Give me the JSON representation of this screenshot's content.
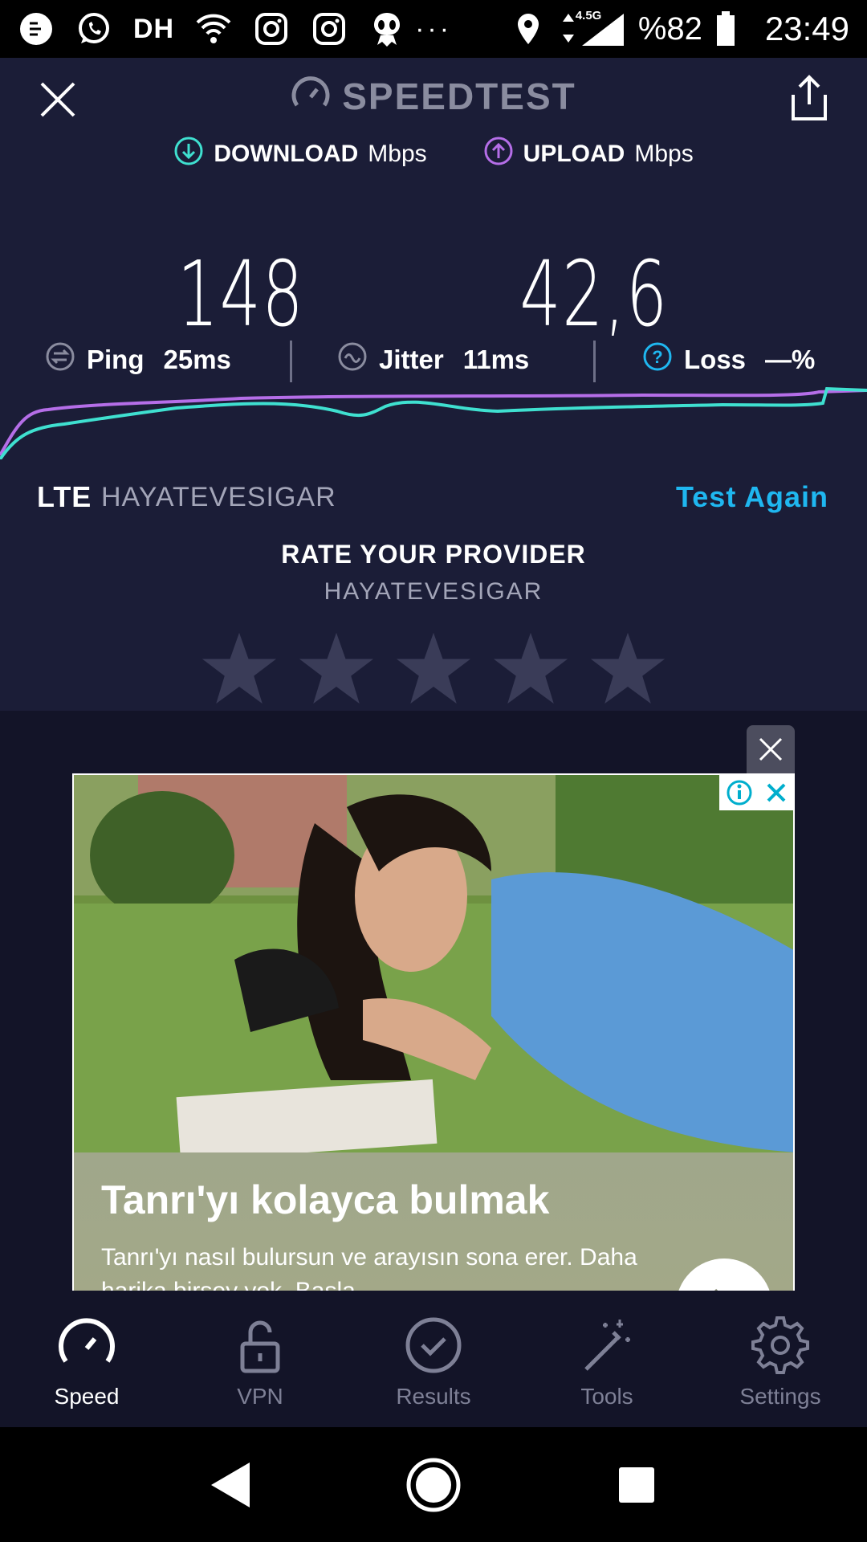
{
  "status_bar": {
    "carrier_text": "DH",
    "network_type": "4.5G",
    "battery": "%82",
    "time": "23:49",
    "more": "···"
  },
  "app": {
    "title": "SPEEDTEST",
    "download_label": "DOWNLOAD",
    "download_unit": "Mbps",
    "download_value": "148",
    "upload_label": "UPLOAD",
    "upload_unit": "Mbps",
    "upload_value": "42,6",
    "ping_label": "Ping",
    "ping_value": "25ms",
    "jitter_label": "Jitter",
    "jitter_value": "11ms",
    "loss_label": "Loss",
    "loss_value": "—%",
    "connection_type": "LTE",
    "provider": "HAYATEVESIGAR",
    "test_again": "Test Again",
    "rate_title": "RATE YOUR PROVIDER",
    "rate_provider": "HAYATEVESIGAR",
    "rating": 0,
    "rating_max": 5
  },
  "colors": {
    "background": "#1b1d37",
    "download_accent": "#3fe0d0",
    "upload_accent": "#b56ee8",
    "link": "#1fb7f0"
  },
  "ad": {
    "headline": "Tanrı'yı kolayca bulmak",
    "body": "Tanrı'yı nasıl bulursun ve arayısın sona erer. Daha harika birsey yok. Basla"
  },
  "tabs": [
    {
      "label": "Speed",
      "icon": "speedometer-icon",
      "active": true
    },
    {
      "label": "VPN",
      "icon": "lock-icon",
      "active": false
    },
    {
      "label": "Results",
      "icon": "check-circle-icon",
      "active": false
    },
    {
      "label": "Tools",
      "icon": "magic-wand-icon",
      "active": false
    },
    {
      "label": "Settings",
      "icon": "gear-icon",
      "active": false
    }
  ]
}
